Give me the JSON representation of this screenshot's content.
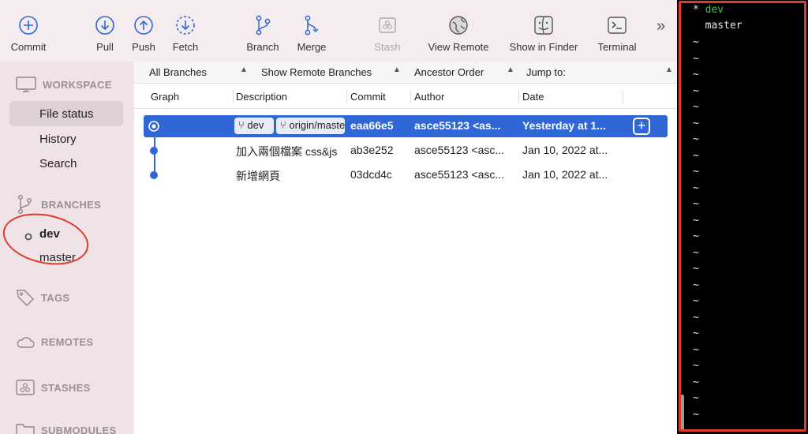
{
  "toolbar": {
    "commit": "Commit",
    "pull": "Pull",
    "push": "Push",
    "fetch": "Fetch",
    "branch": "Branch",
    "merge": "Merge",
    "stash": "Stash",
    "view_remote": "View Remote",
    "show_in_finder": "Show in Finder",
    "terminal": "Terminal",
    "more": "»"
  },
  "sidebar": {
    "workspace": "WORKSPACE",
    "file_status": "File status",
    "history": "History",
    "search": "Search",
    "branches": "BRANCHES",
    "branch_items": [
      "dev",
      "master"
    ],
    "tags": "TAGS",
    "remotes": "REMOTES",
    "stashes": "STASHES",
    "submodules": "SUBMODULES"
  },
  "filters": {
    "branches": "All Branches",
    "remote": "Show Remote Branches",
    "order": "Ancestor Order",
    "jump": "Jump to:"
  },
  "columns": [
    "Graph",
    "Description",
    "Commit",
    "Author",
    "Date"
  ],
  "commits": [
    {
      "badges": [
        "dev",
        "origin/master"
      ],
      "description": "",
      "commit": "eaa66e5",
      "author": "asce55123 <as...",
      "date": "Yesterday at 1..."
    },
    {
      "badges": [],
      "description": "加入兩個檔案 css&js",
      "commit": "ab3e252",
      "author": "asce55123 <asc...",
      "date": "Jan 10, 2022 at..."
    },
    {
      "badges": [],
      "description": "新增網頁",
      "commit": "03dcd4c",
      "author": "asce55123 <asc...",
      "date": "Jan 10, 2022 at..."
    }
  ],
  "terminal": {
    "current_marker": "* ",
    "current_branch": "dev",
    "other_branch": "  master",
    "tilde": "~"
  },
  "colors": {
    "selection": "#2f67d6",
    "accent_blue": "#2f67d6",
    "terminal_green": "#3ec43e",
    "annotation_red": "#e03b2a"
  }
}
